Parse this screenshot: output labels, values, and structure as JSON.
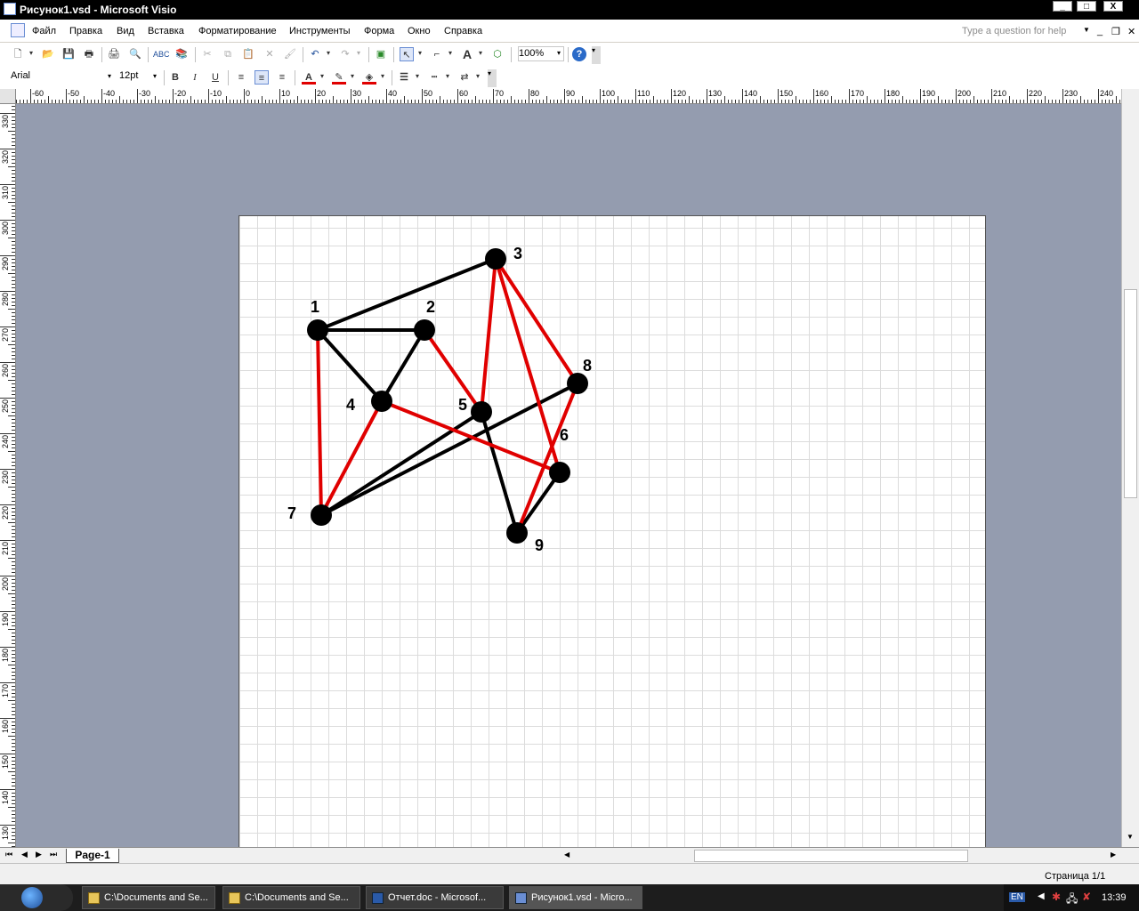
{
  "window": {
    "title": "Рисунок1.vsd - Microsoft Visio",
    "min": "_",
    "max": "□",
    "close": "X"
  },
  "menu": [
    "Файл",
    "Правка",
    "Вид",
    "Вставка",
    "Форматирование",
    "Инструменты",
    "Форма",
    "Окно",
    "Справка"
  ],
  "help_placeholder": "Type a question for help",
  "toolbar": {
    "zoom": "100%",
    "font": "Arial",
    "size": "12pt",
    "bold": "B",
    "italic": "I",
    "underline": "U",
    "text_tool": "A"
  },
  "ruler": {
    "h_labels": [
      "-60",
      "-50",
      "-40",
      "-30",
      "-20",
      "-10",
      "0",
      "10",
      "20",
      "30",
      "40",
      "50",
      "60",
      "70",
      "80",
      "90",
      "100",
      "110",
      "120",
      "130",
      "140",
      "150",
      "160",
      "170",
      "180",
      "190",
      "200",
      "210",
      "220",
      "230",
      "240"
    ],
    "v_labels": [
      "330",
      "320",
      "310",
      "300",
      "290",
      "280",
      "270",
      "260",
      "250",
      "240",
      "230",
      "220",
      "210",
      "200",
      "190",
      "180",
      "170",
      "160",
      "150",
      "140",
      "130"
    ]
  },
  "graph": {
    "nodes": [
      {
        "id": "1",
        "label": "1"
      },
      {
        "id": "2",
        "label": "2"
      },
      {
        "id": "3",
        "label": "3"
      },
      {
        "id": "4",
        "label": "4"
      },
      {
        "id": "5",
        "label": "5"
      },
      {
        "id": "6",
        "label": "6"
      },
      {
        "id": "7",
        "label": "7"
      },
      {
        "id": "8",
        "label": "8"
      },
      {
        "id": "9",
        "label": "9"
      }
    ],
    "edges_black": [
      [
        "1",
        "3"
      ],
      [
        "1",
        "2"
      ],
      [
        "1",
        "4"
      ],
      [
        "2",
        "4"
      ],
      [
        "5",
        "9"
      ],
      [
        "6",
        "9"
      ],
      [
        "7",
        "8"
      ],
      [
        "7",
        "5"
      ]
    ],
    "edges_red": [
      [
        "1",
        "7"
      ],
      [
        "4",
        "7"
      ],
      [
        "4",
        "6"
      ],
      [
        "2",
        "5"
      ],
      [
        "3",
        "5"
      ],
      [
        "3",
        "8"
      ],
      [
        "3",
        "6"
      ],
      [
        "8",
        "9"
      ]
    ],
    "colors": {
      "black": "#000000",
      "red": "#e00000"
    }
  },
  "tabs": {
    "page": "Page-1"
  },
  "status": {
    "page_info": "Страница 1/1"
  },
  "taskbar": {
    "items": [
      "C:\\Documents and Se...",
      "C:\\Documents and Se...",
      "Отчет.doc - Microsof...",
      "Рисунок1.vsd - Micro..."
    ],
    "lang": "EN",
    "clock": "13:39"
  }
}
